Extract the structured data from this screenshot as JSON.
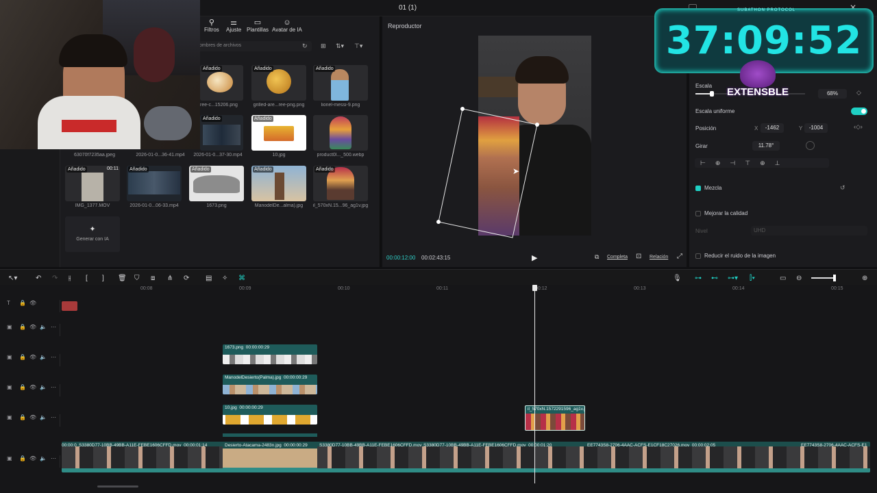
{
  "window": {
    "title": "01 (1)"
  },
  "toolbar": {
    "items": [
      {
        "label": "Filtros",
        "icon": "filter-icon"
      },
      {
        "label": "Ajuste",
        "icon": "sliders-icon"
      },
      {
        "label": "Plantillas",
        "icon": "template-icon"
      },
      {
        "label": "Avatar de IA",
        "icon": "avatar-icon"
      }
    ]
  },
  "media": {
    "search_placeholder": "ombres de archivos",
    "added_tag": "Añadido",
    "items": [
      {
        "name": "ree-c...15206.png",
        "added": true
      },
      {
        "name": "grilled-are...ree-png.png",
        "added": true
      },
      {
        "name": "lionel-messi-9.png",
        "added": true
      },
      {
        "name": "2026-01-0...37-30.mp4",
        "added": true
      },
      {
        "name": "10.jpg",
        "added": true
      },
      {
        "name": "product0l..._500.webp",
        "added": false
      },
      {
        "name": "IMG_1377.MOV",
        "added": true,
        "duration": "00:11"
      },
      {
        "name": "2026-01-0...06-33.mp4",
        "added": true
      },
      {
        "name": "1673.png",
        "added": true
      },
      {
        "name": "ManodelDe...alma).jpg",
        "added": true
      },
      {
        "name": "il_570xN.15...96_ag1v.jpg",
        "added": true
      }
    ],
    "partial_captions": [
      "63070f7235aa.jpeg",
      "2026-01-0...36-41.mp4"
    ],
    "generate_label": "Generar con IA"
  },
  "player": {
    "title": "Reproductor",
    "current_time": "00:00:12:00",
    "total_time": "00:02:43:15",
    "full_label": "Completa",
    "ratio_label": "Relación"
  },
  "inspector": {
    "scale_label": "Escala",
    "scale_value": "68%",
    "scale_fraction": 0.68,
    "uniform_label": "Escala uniforme",
    "position_label": "Posición",
    "x_label": "X",
    "x_value": "-1462",
    "y_label": "Y",
    "y_value": "-1004",
    "rotate_label": "Girar",
    "rotate_value": "11.78°",
    "blend_label": "Mezcla",
    "enhance_label": "Mejorar la calidad",
    "level_label": "Nivel",
    "level_value": "UHD",
    "noise_label": "Reducir el ruido de la imagen"
  },
  "overlay": {
    "timer": "37:09:52",
    "subathon": "SUBATHON PROTOCOL",
    "logo_text": "EXTENSBLE"
  },
  "timeline": {
    "ticks": [
      "00:08",
      "00:09",
      "00:10",
      "00:11",
      "00:12",
      "00:13",
      "00:14",
      "00:15"
    ],
    "clips": {
      "img1673": {
        "name": "1673.png",
        "dur": "00:00:00:29"
      },
      "mano": {
        "name": "ManodelDesierto(Palma).jpg",
        "dur": "00:00:00:29"
      },
      "ten": {
        "name": "10.jpg",
        "dur": "00:00:00:29"
      },
      "il": {
        "name": "il_570xN.1572291596_ag1v.j"
      },
      "main1": {
        "name": "S3380D77-10BB-49BB-A11E-FEBE1606CFFD.mov",
        "dur": "00:00:01:14"
      },
      "desierto": {
        "name": "Desierto-Atacama-2483n.jpg",
        "dur": "00:00:00:29"
      },
      "main2": {
        "name": "S3380D77-10BB-49BB-A11E-FEBE1606CFFD.mov",
        "dur": "00:00:01:20"
      },
      "main3": {
        "name": "EE7743S8-2706-4AAC-ACFS-E1CF18C27026.mov",
        "dur": "00:00:02:05"
      },
      "main4": {
        "name": "EE7743S8-2706-4AAC-ACFS-E1"
      },
      "start": {
        "name": "00:00:0"
      }
    }
  },
  "colors": {
    "accent": "#22e4e4",
    "clip": "#1e5b5a",
    "selected": "#bfeee8"
  }
}
